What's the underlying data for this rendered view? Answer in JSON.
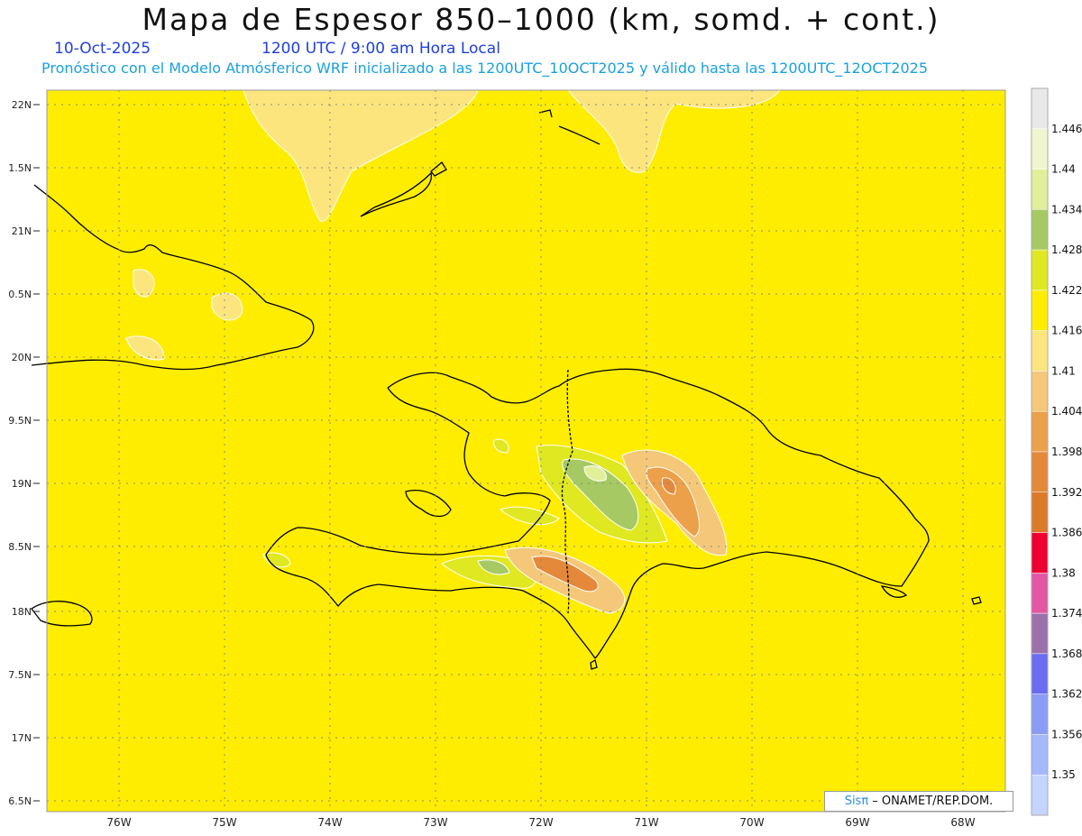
{
  "header": {
    "title": "Mapa de Espesor 850–1000 (km, somd. + cont.)",
    "date": "10-Oct-2025",
    "time": "1200 UTC / 9:00 am Hora Local",
    "forecast": "Pronóstico con el Modelo Atmósferico WRF inicializado a las 1200UTC_10OCT2025 y válido hasta las  1200UTC_12OCT2025"
  },
  "axes": {
    "lon_labels": [
      "76W",
      "75W",
      "74W",
      "73W",
      "72W",
      "71W",
      "70W",
      "69W",
      "68W"
    ],
    "lat_labels": [
      "22N",
      "1.5N",
      "21N",
      "0.5N",
      "20N",
      "9.5N",
      "19N",
      "8.5N",
      "18N",
      "7.5N",
      "17N",
      "6.5N"
    ]
  },
  "colorbar": {
    "labels": [
      "1.446",
      "1.44",
      "1.434",
      "1.428",
      "1.422",
      "1.416",
      "1.41",
      "1.404",
      "1.398",
      "1.392",
      "1.386",
      "1.38",
      "1.374",
      "1.368",
      "1.362",
      "1.356",
      "1.35"
    ],
    "colors": [
      "#e8e8e8",
      "#f0f5d0",
      "#e2ef9a",
      "#a6c964",
      "#dfe820",
      "#ffed00",
      "#fde57e",
      "#f4c878",
      "#eca04a",
      "#e4883a",
      "#dc7a2a",
      "#ee0030",
      "#e356a4",
      "#9c70a8",
      "#6a6cf2",
      "#8a9cf6",
      "#a4b8fa",
      "#c4d4fc"
    ]
  },
  "credit": {
    "sis": "Sisπ",
    "text": " – ONAMET/REP.DOM."
  },
  "map_data": {
    "base_color": "#ffed00",
    "coast_color": "#000000"
  }
}
